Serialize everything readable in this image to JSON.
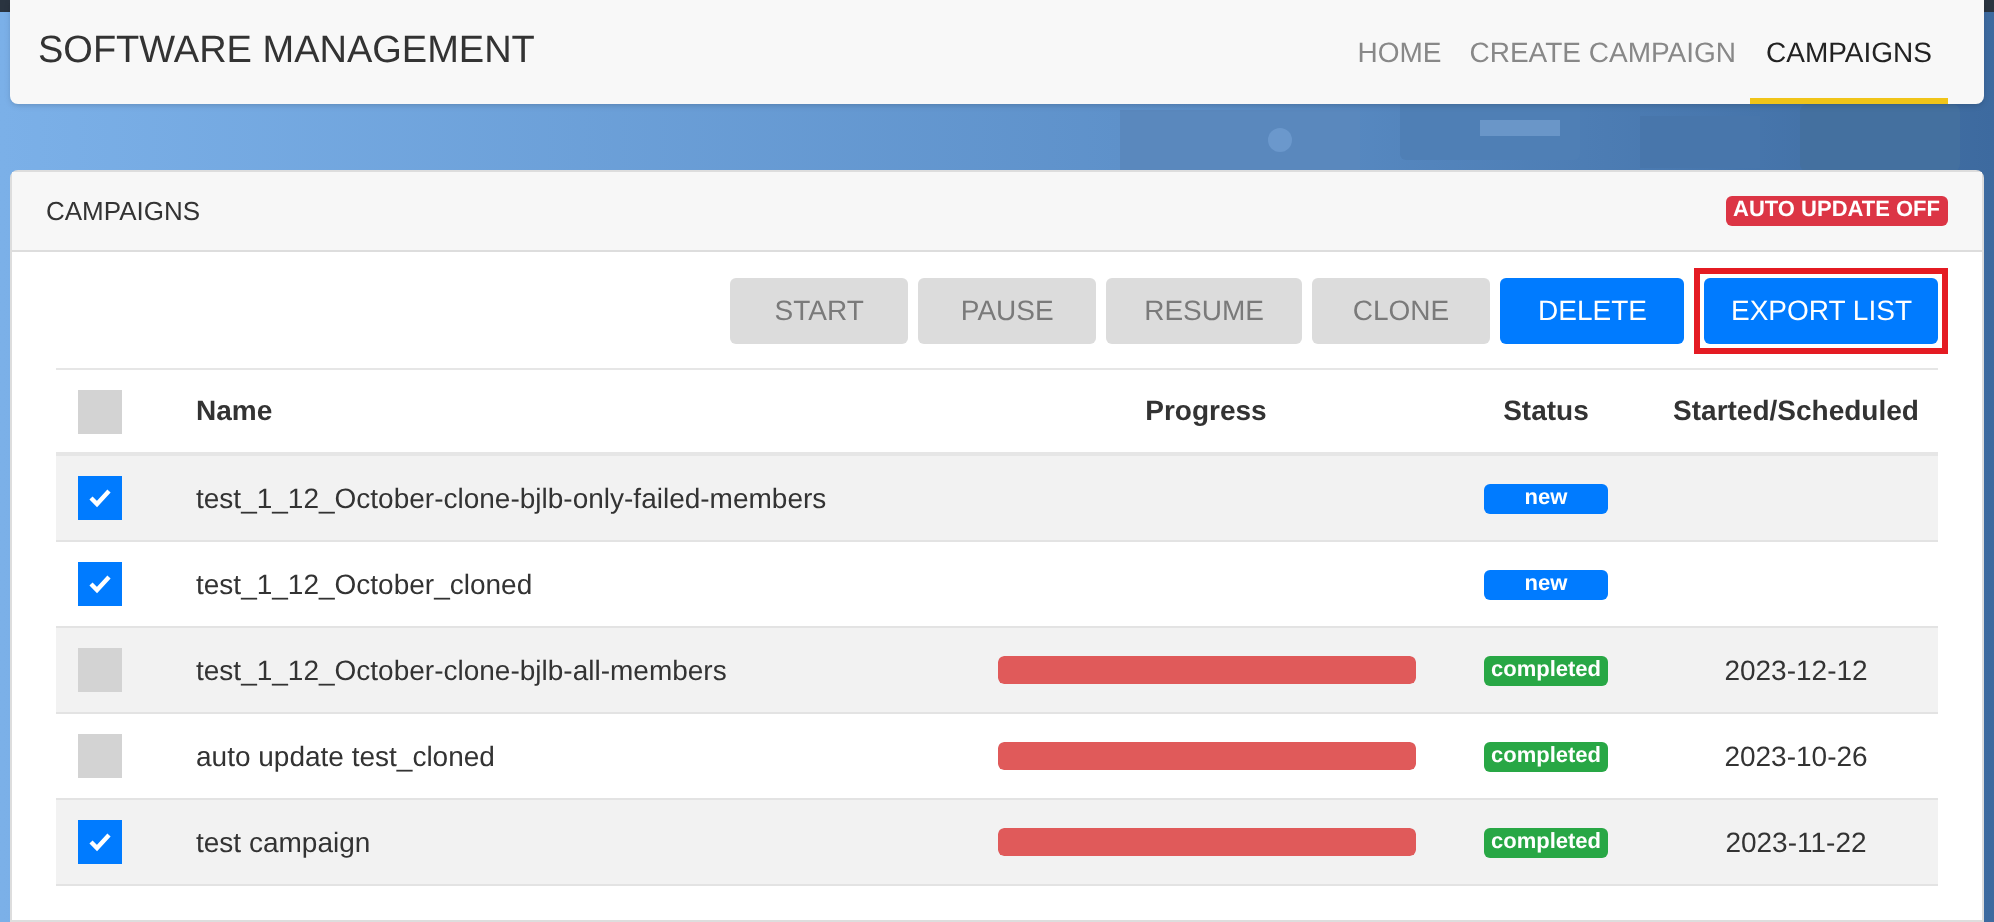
{
  "app_title": "SOFTWARE MANAGEMENT",
  "nav": [
    {
      "label": "HOME",
      "selected": false
    },
    {
      "label": "CREATE CAMPAIGN",
      "selected": false
    },
    {
      "label": "CAMPAIGNS",
      "selected": true
    }
  ],
  "panel": {
    "title": "CAMPAIGNS",
    "auto_update_badge": "AUTO UPDATE OFF"
  },
  "buttons": [
    {
      "label": "START",
      "disabled": true,
      "highlighted": false
    },
    {
      "label": "PAUSE",
      "disabled": true,
      "highlighted": false
    },
    {
      "label": "RESUME",
      "disabled": true,
      "highlighted": false
    },
    {
      "label": "CLONE",
      "disabled": true,
      "highlighted": false
    },
    {
      "label": "DELETE",
      "disabled": false,
      "highlighted": false
    },
    {
      "label": "EXPORT LIST",
      "disabled": false,
      "highlighted": true
    }
  ],
  "table": {
    "select_all_checked": false,
    "columns": [
      "Name",
      "Progress",
      "Status",
      "Started/Scheduled"
    ],
    "rows": [
      {
        "checked": true,
        "name": "test_1_12_October-clone-bjlb-only-failed-members",
        "status": {
          "label": "new",
          "color": "#007bff"
        }
      },
      {
        "checked": true,
        "name": "test_1_12_October_cloned",
        "status": {
          "label": "new",
          "color": "#007bff"
        }
      },
      {
        "checked": false,
        "name": "test_1_12_October-clone-bjlb-all-members",
        "level": 1,
        "status": {
          "label": "completed",
          "color": "#28a745"
        },
        "started": "2023-12-12"
      },
      {
        "checked": false,
        "name": "auto update test_cloned",
        "level": 1,
        "status": {
          "label": "completed",
          "color": "#28a745"
        },
        "started": "2023-10-26"
      },
      {
        "checked": true,
        "name": "test campaign",
        "level": 1,
        "status": {
          "label": "completed",
          "color": "#28a745"
        },
        "started": "2023-11-22"
      }
    ]
  }
}
